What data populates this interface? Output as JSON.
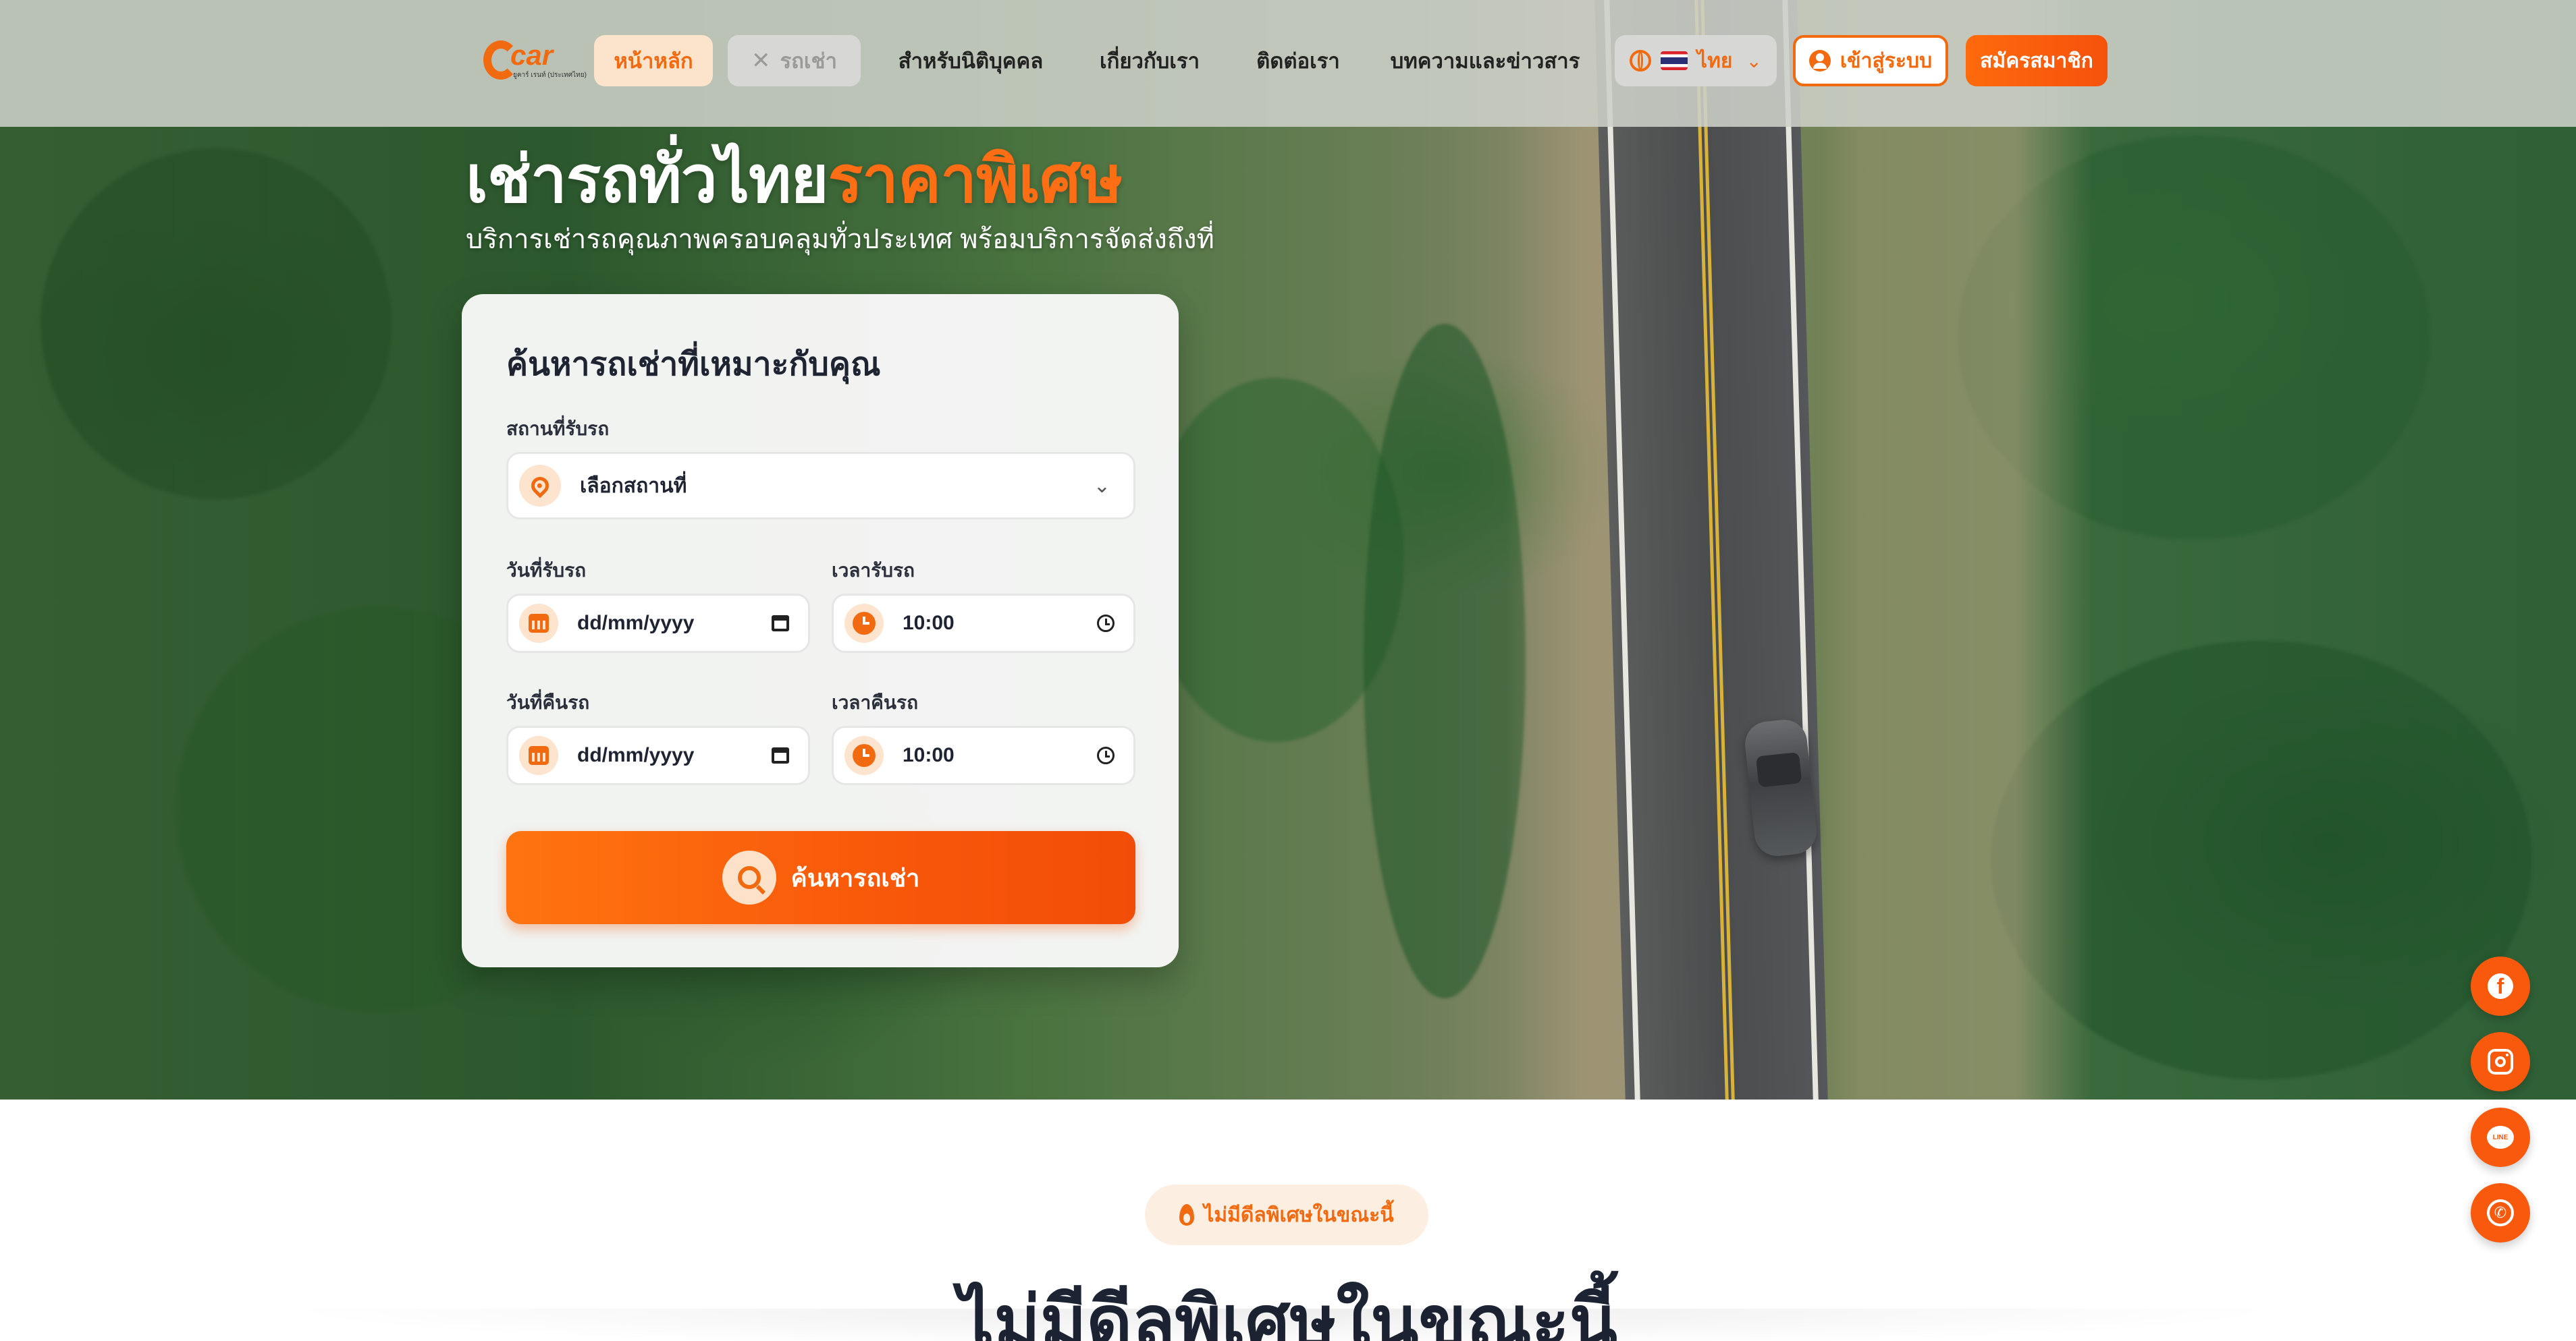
{
  "nav": {
    "logo_text": "car",
    "logo_sub": "ยูคาร์ เรนท์ (ประเทศไทย)",
    "items": [
      {
        "label": "หน้าหลัก"
      },
      {
        "label": "รถเช่า"
      },
      {
        "label": "สำหรับนิติบุคคล"
      },
      {
        "label": "เกี่ยวกับเรา"
      },
      {
        "label": "ติดต่อเรา"
      },
      {
        "label": "บทความและข่าวสาร"
      }
    ],
    "language": "ไทย",
    "login_label": "เข้าสู่ระบบ",
    "register_label": "สมัครสมาชิก"
  },
  "hero": {
    "title_main": "เช่ารถทั่วไทย",
    "title_accent": "ราคาพิเศษ",
    "subtitle": "บริการเช่ารถคุณภาพครอบคลุมทั่วประเทศ พร้อมบริการจัดส่งถึงที่"
  },
  "search": {
    "title": "ค้นหารถเช่าที่เหมาะกับคุณ",
    "pickup_location_label": "สถานที่รับรถ",
    "pickup_location_value": "เลือกสถานที่",
    "pickup_date_label": "วันที่รับรถ",
    "pickup_date_value": "dd/mm/yyyy",
    "pickup_time_label": "เวลารับรถ",
    "pickup_time_value": "10:00",
    "return_date_label": "วันที่คืนรถ",
    "return_date_value": "dd/mm/yyyy",
    "return_time_label": "เวลาคืนรถ",
    "return_time_value": "10:00",
    "button_label": "ค้นหารถเช่า"
  },
  "deals": {
    "badge": "ไม่มีดีลพิเศษในขณะนี้",
    "heading": "ไม่มีดีลพิเศษในขณะนี้"
  },
  "colors": {
    "accent": "#f26a10",
    "dark_text": "#1c2333"
  },
  "social": [
    "facebook-icon",
    "instagram-icon",
    "line-icon",
    "whatsapp-icon"
  ]
}
